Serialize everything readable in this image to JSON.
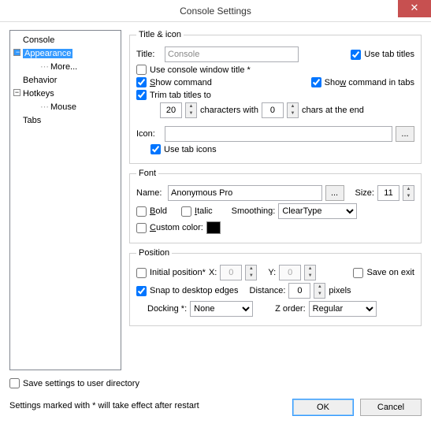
{
  "window": {
    "title": "Console Settings",
    "close_glyph": "✕"
  },
  "tree": {
    "items": [
      {
        "label": "Console",
        "toggle": ""
      },
      {
        "label": "Appearance",
        "toggle": "−",
        "selected": true
      },
      {
        "label": "More...",
        "child": true
      },
      {
        "label": "Behavior",
        "toggle": ""
      },
      {
        "label": "Hotkeys",
        "toggle": "−"
      },
      {
        "label": "Mouse",
        "child": true
      },
      {
        "label": "Tabs",
        "toggle": ""
      }
    ]
  },
  "title_icon": {
    "legend": "Title & icon",
    "title_lbl": "Title:",
    "title_val": "Console",
    "use_tab_titles": "Use tab titles",
    "use_console_window": "Use console window title *",
    "show_command": "Show command",
    "show_command_tabs": "Show command in tabs",
    "trim_tab": "Trim tab titles to",
    "trim_val": "20",
    "chars_with": "characters with",
    "end_val": "0",
    "chars_end": "chars at the end",
    "icon_lbl": "Icon:",
    "icon_btn": "...",
    "use_tab_icons": "Use tab icons"
  },
  "font": {
    "legend": "Font",
    "name_lbl": "Name:",
    "name_val": "Anonymous Pro",
    "name_btn": "...",
    "size_lbl": "Size:",
    "size_val": "11",
    "bold": "Bold",
    "italic": "Italic",
    "smoothing_lbl": "Smoothing:",
    "smoothing_val": "ClearType",
    "custom_color": "Custom color:"
  },
  "position": {
    "legend": "Position",
    "initial": "Initial position*",
    "x_lbl": "X:",
    "x_val": "0",
    "y_lbl": "Y:",
    "y_val": "0",
    "save_exit": "Save on exit",
    "snap": "Snap to desktop edges",
    "distance_lbl": "Distance:",
    "distance_val": "0",
    "pixels": "pixels",
    "docking_lbl": "Docking *:",
    "docking_val": "None",
    "zorder_lbl": "Z order:",
    "zorder_val": "Regular"
  },
  "bottom": {
    "save_dir": "Save settings to user directory",
    "note": "Settings marked with * will take effect after restart",
    "ok": "OK",
    "cancel": "Cancel"
  }
}
